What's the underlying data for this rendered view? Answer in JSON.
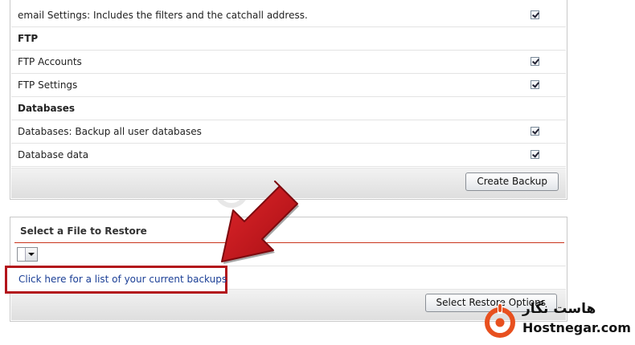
{
  "backup": {
    "rows": [
      {
        "type": "option",
        "label": "email Settings: Includes the filters and the catchall address.",
        "checked": true
      },
      {
        "type": "section",
        "label": "FTP"
      },
      {
        "type": "option",
        "label": "FTP Accounts",
        "checked": true
      },
      {
        "type": "option",
        "label": "FTP Settings",
        "checked": true
      },
      {
        "type": "section",
        "label": "Databases"
      },
      {
        "type": "option",
        "label": "Databases: Backup all user databases",
        "checked": true
      },
      {
        "type": "option",
        "label": "Database data",
        "checked": true
      }
    ],
    "create_button": "Create Backup"
  },
  "restore": {
    "title": "Select a File to Restore",
    "select_value": "",
    "link_text": "Click here for a list of your current backups",
    "options_button": "Select Restore Options"
  },
  "brand": {
    "name_fa": "هاست نگار",
    "name_en": "Hostnegar.com",
    "accent": "#e8501f"
  },
  "colors": {
    "highlight_box": "#b3141b",
    "arrow": "#c4161c",
    "link": "#1b3f96"
  }
}
